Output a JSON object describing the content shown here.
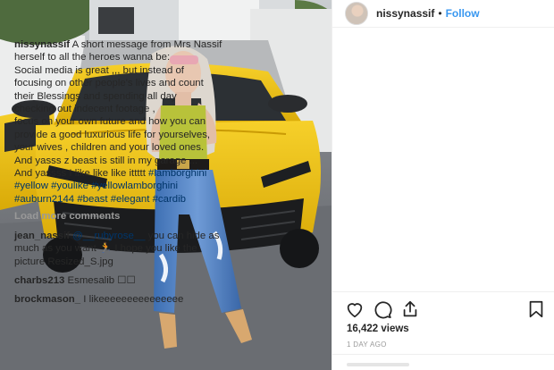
{
  "post": {
    "username": "nissynassif",
    "separator": "•",
    "follow_label": "Follow",
    "caption_lines": [
      "A short message from Mrs Nassif",
      "herself to all the heroes wanna be:",
      "Social media is great ,,, but instead of",
      "focusing on other people's lives and count",
      "their Blessings and spending all day",
      "checking out indecent footage ,",
      "focus on your own future and how you can",
      "provide a good luxurious life for yourselves,",
      "your wives , children and your loved ones.",
      "And yasss z beast is still in my garage ...",
      "And yassss I like like like ittttt"
    ],
    "hashtags": {
      "lamborghini": "#lamborghini",
      "yellow": "#yellow",
      "youlike": "#youlike",
      "yellowlamborghini": "#yellowlamborghini",
      "auburn2144": "#auburn2144",
      "beast": "#beast",
      "elegant": "#elegant",
      "cardib": "#cardib"
    },
    "load_more": "Load more comments",
    "comments": [
      {
        "user": "jean_nassif",
        "mention": "@__rubyrose__",
        "line1_rest": " you can hide as",
        "line2": "much as you want 🏃 I hope you like the",
        "line3": "picture Resized_S.jpg"
      },
      {
        "user": "charbs213",
        "text": " Esmesalib ☐☐"
      },
      {
        "user": "brockmason_",
        "text": " I likeeeeeeeeeeeeeee"
      }
    ],
    "likes": "16,422 views",
    "time": "1 DAY AGO"
  },
  "icons": {
    "like": "heart-icon",
    "comment": "comment-icon",
    "share": "share-icon",
    "save": "bookmark-icon"
  },
  "colors": {
    "link": "#3897f0",
    "hashtag": "#003569",
    "muted": "#999999",
    "car_yellow": "#f2c414"
  }
}
